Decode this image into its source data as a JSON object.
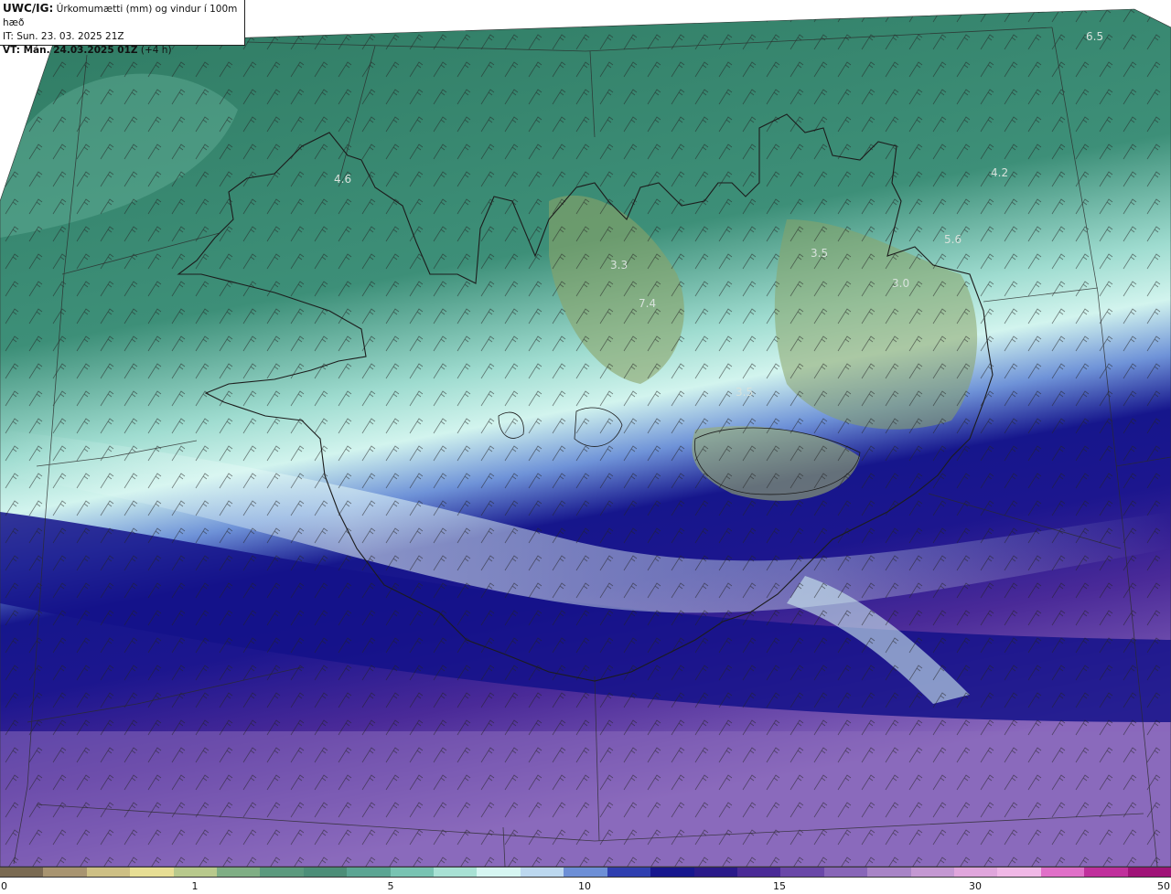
{
  "header": {
    "model": "UWC/IG:",
    "title": "Úrkomumætti (mm) og vindur í 100m hæð",
    "it_line": "IT: Sun. 23. 03. 2025 21Z",
    "vt_label": "VT: Mán. 24.03.2025 01Z",
    "vt_suffix": "(+4 h)"
  },
  "map_labels": [
    "6.5",
    "4.6",
    "4.2",
    "5.6",
    "3.5",
    "3.3",
    "3.0",
    "7.4",
    "3.5"
  ],
  "colorbar": {
    "ticks": [
      "0",
      "1",
      "5",
      "10",
      "15",
      "30",
      "50"
    ],
    "colors": [
      "#7a6a52",
      "#a89470",
      "#cdbf84",
      "#e7de94",
      "#b8c98c",
      "#7fae84",
      "#5b9a7e",
      "#4c8e78",
      "#5ba593",
      "#78c3b2",
      "#a8e1d4",
      "#d6f6f2",
      "#bcd8ef",
      "#6d8fd6",
      "#2f3fb0",
      "#17178e",
      "#2a1a8a",
      "#4a2a96",
      "#6a48a8",
      "#8866b8",
      "#a884c6",
      "#c498d2",
      "#e0a6dc",
      "#f0b8e6",
      "#e070c8",
      "#c0309c",
      "#a01478"
    ]
  }
}
